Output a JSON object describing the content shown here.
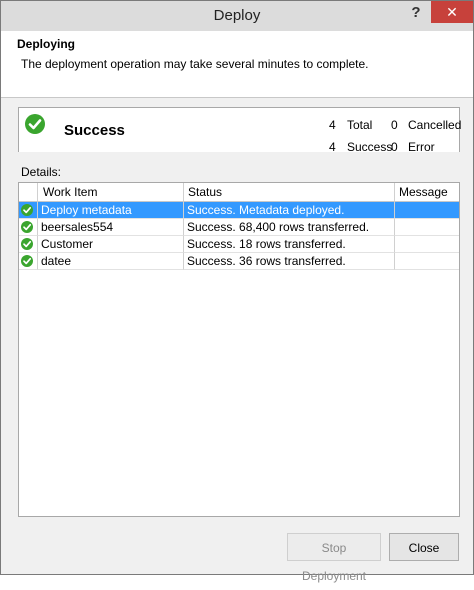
{
  "window": {
    "title": "Deploy",
    "help": "?",
    "close": "✕"
  },
  "header": {
    "title": "Deploying",
    "description": "The deployment operation may take several minutes to complete."
  },
  "summary": {
    "status": "Success",
    "stats": [
      {
        "count": "4",
        "label": "Total"
      },
      {
        "count": "0",
        "label": "Cancelled"
      },
      {
        "count": "4",
        "label": "Success"
      },
      {
        "count": "0",
        "label": "Error"
      }
    ]
  },
  "details": {
    "label": "Details:",
    "columns": [
      "Work Item",
      "Status",
      "Message"
    ],
    "rows": [
      {
        "item": "Deploy metadata",
        "status": "Success. Metadata deployed.",
        "message": ""
      },
      {
        "item": "beersales554",
        "status": "Success. 68,400 rows transferred.",
        "message": ""
      },
      {
        "item": "Customer",
        "status": "Success. 18 rows transferred.",
        "message": ""
      },
      {
        "item": "datee",
        "status": "Success. 36 rows transferred.",
        "message": ""
      }
    ]
  },
  "buttons": {
    "stop": "Stop Deployment",
    "close": "Close"
  },
  "colors": {
    "success": "#3aa52e",
    "selection": "#3399ff",
    "close_red": "#c7413b"
  }
}
